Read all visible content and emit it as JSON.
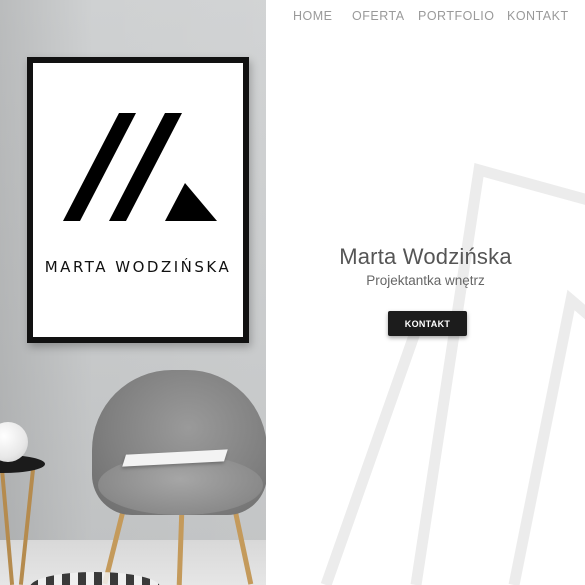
{
  "nav": {
    "items": [
      {
        "label": "HOME"
      },
      {
        "label": "OFERTA"
      },
      {
        "label": "PORTFOLIO"
      },
      {
        "label": "KONTAKT"
      }
    ]
  },
  "hero": {
    "poster_text": "MARTA WODZIŃSKA",
    "name": "Marta Wodzińska",
    "subtitle": "Projektantka wnętrz",
    "cta_label": "KONTAKT"
  },
  "colors": {
    "nav_text": "#9a9a9a",
    "heading": "#555555",
    "button_bg": "#1c1c1c",
    "button_text": "#ffffff"
  }
}
